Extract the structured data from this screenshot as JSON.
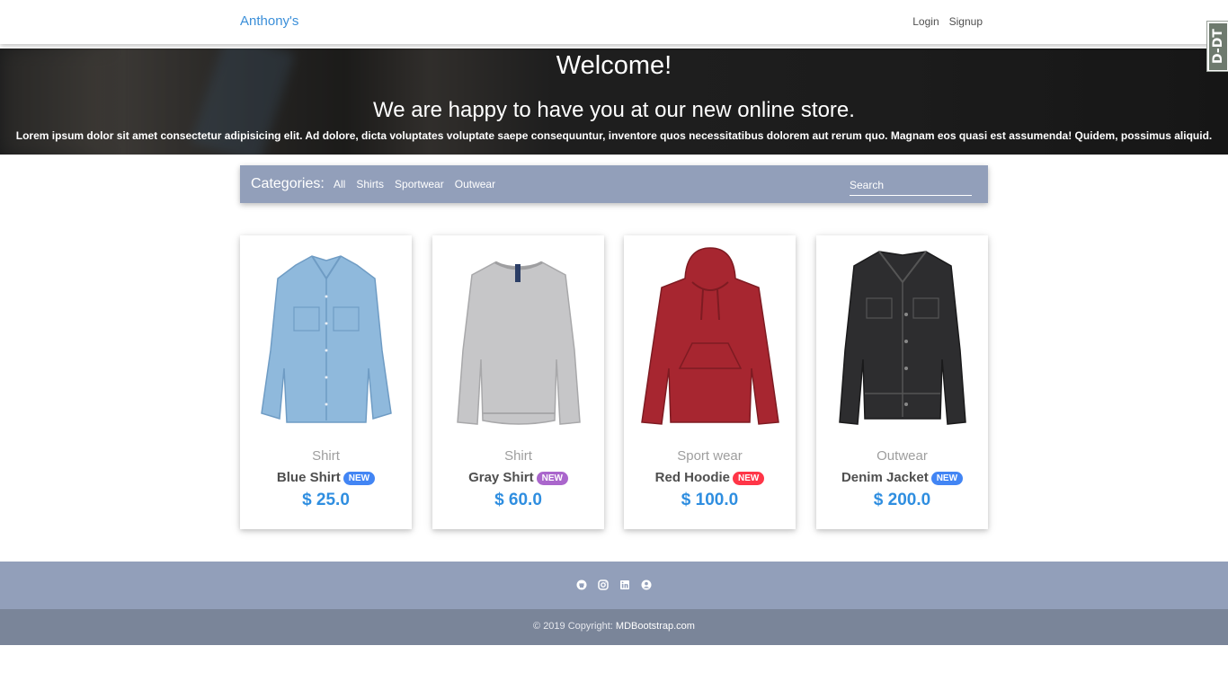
{
  "navbar": {
    "brand": "Anthony's",
    "login": "Login",
    "signup": "Signup",
    "ext_badge": "D-DT"
  },
  "hero": {
    "title": "Welcome!",
    "subtitle": "We are happy to have you at our new online store.",
    "text": "Lorem ipsum dolor sit amet consectetur adipisicing elit. Ad dolore, dicta voluptates voluptate saepe consequuntur, inventore quos necessitatibus dolorem aut rerum quo. Magnam eos quasi est assumenda! Quidem, possimus aliquid."
  },
  "categories": {
    "label": "Categories:",
    "items": [
      "All",
      "Shirts",
      "Sportwear",
      "Outwear"
    ],
    "search_placeholder": "Search"
  },
  "products": [
    {
      "category": "Shirt",
      "name": "Blue Shirt",
      "badge": "NEW",
      "badge_color": "#4285f4",
      "price": "$ 25.0",
      "image": "blue-denim-shirt"
    },
    {
      "category": "Shirt",
      "name": "Gray Shirt",
      "badge": "NEW",
      "badge_color": "#aa66cc",
      "price": "$ 60.0",
      "image": "gray-sweatshirt"
    },
    {
      "category": "Sport wear",
      "name": "Red Hoodie",
      "badge": "NEW",
      "badge_color": "#ff3547",
      "price": "$ 100.0",
      "image": "red-hoodie"
    },
    {
      "category": "Outwear",
      "name": "Denim Jacket",
      "badge": "NEW",
      "badge_color": "#4285f4",
      "price": "$ 200.0",
      "image": "black-denim-jacket"
    }
  ],
  "footer": {
    "social_icons": [
      "github-icon",
      "instagram-icon",
      "linkedin-icon",
      "user-circle-icon"
    ],
    "copyright_prefix": "© 2019 Copyright:",
    "copyright_link": "MDBootstrap.com"
  },
  "colors": {
    "brand": "#3b8fd9",
    "category_bar": "#929fba",
    "footer_top": "#929fba",
    "footer_bottom": "#7a8599",
    "price": "#2f8ee0"
  }
}
